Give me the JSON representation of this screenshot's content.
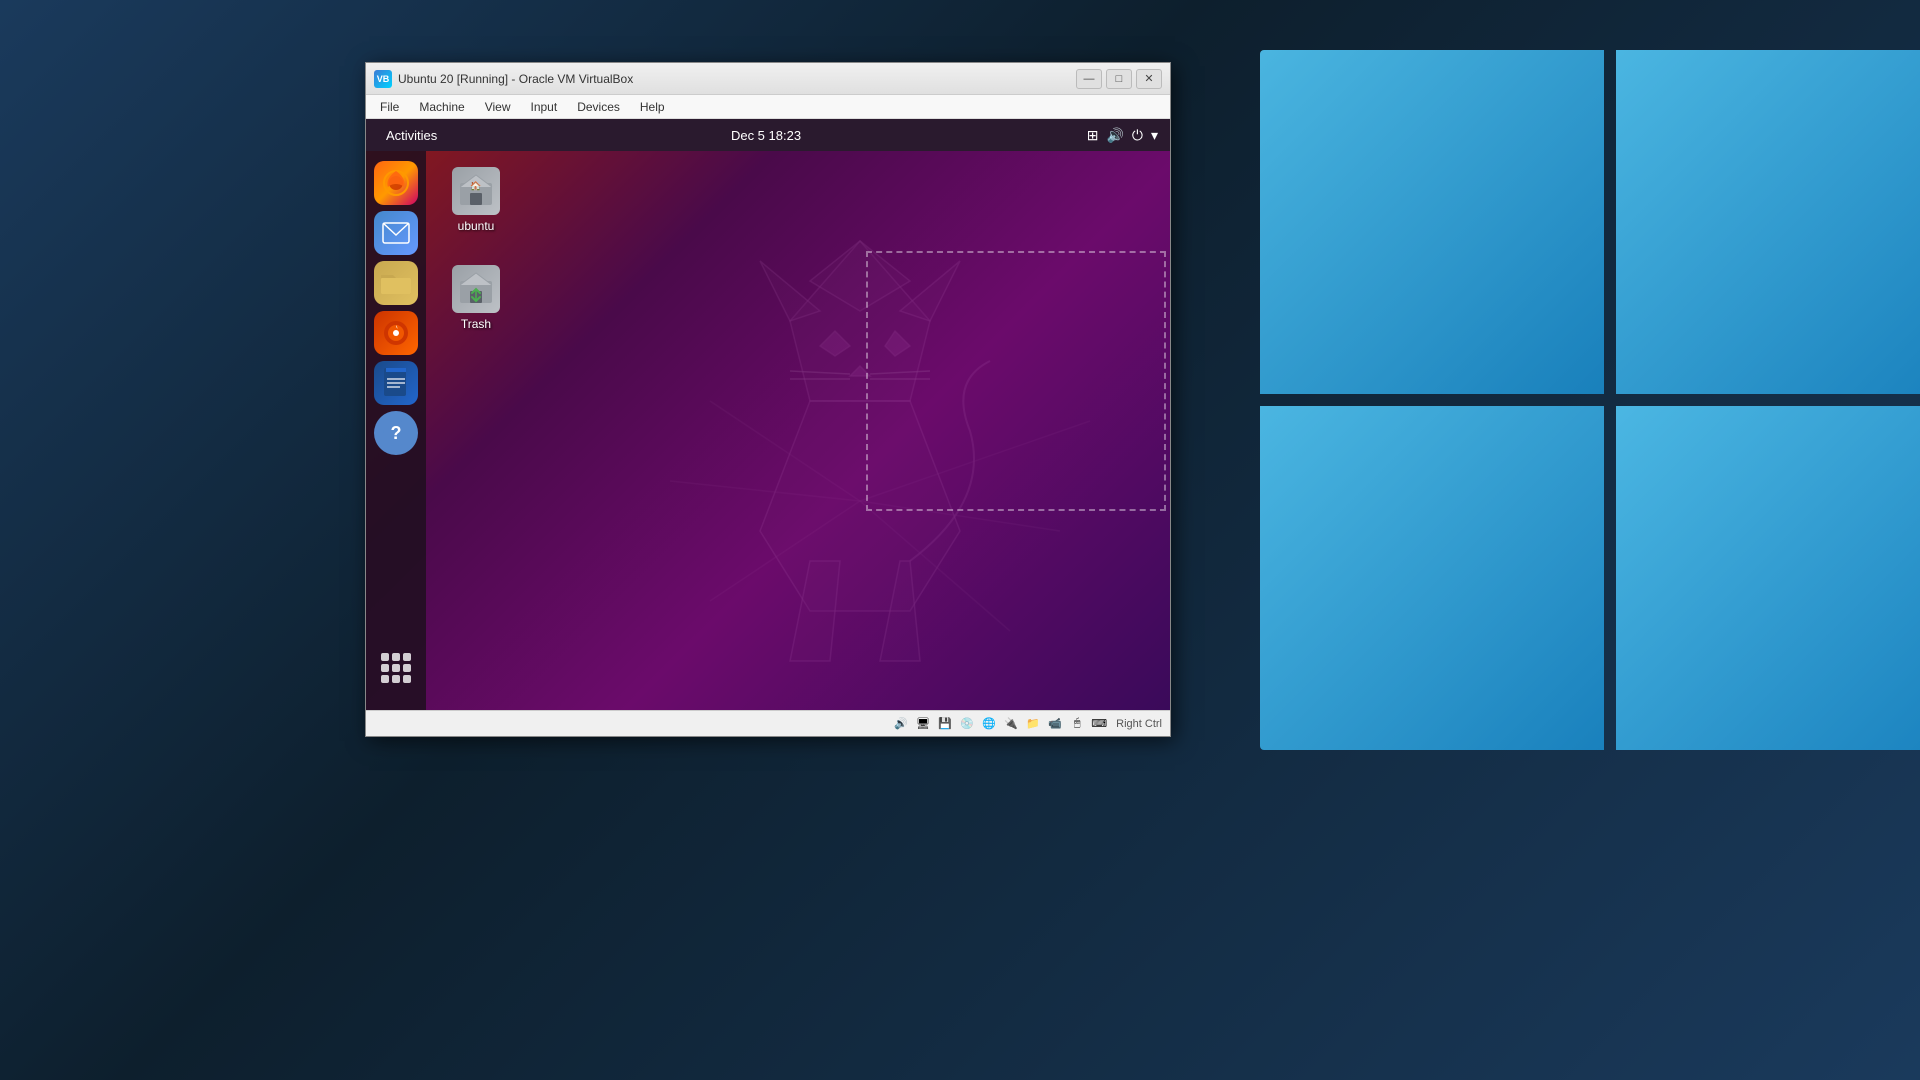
{
  "windows_desktop": {
    "background": "#1a2a3a"
  },
  "vbox_window": {
    "title": "Ubuntu 20 [Running] - Oracle VM VirtualBox",
    "icon": "VB",
    "controls": {
      "minimize": "—",
      "maximize": "□",
      "close": "✕"
    },
    "menubar": {
      "items": [
        "File",
        "Machine",
        "View",
        "Input",
        "Devices",
        "Help"
      ]
    }
  },
  "ubuntu": {
    "topbar": {
      "activities": "Activities",
      "clock": "Dec 5  18:23",
      "icons": [
        "⊞",
        "🔊",
        "⏻",
        "▾"
      ]
    },
    "sidebar": {
      "icons": [
        {
          "name": "firefox",
          "label": "Firefox"
        },
        {
          "name": "email",
          "label": "Email"
        },
        {
          "name": "files",
          "label": "Files"
        },
        {
          "name": "music",
          "label": "Rhythmbox"
        },
        {
          "name": "writer",
          "label": "Writer"
        },
        {
          "name": "help",
          "label": "Help"
        }
      ],
      "apps_grid_label": "Show Applications"
    },
    "desktop_icons": [
      {
        "name": "ubuntu-home",
        "label": "ubuntu",
        "type": "home"
      },
      {
        "name": "trash",
        "label": "Trash",
        "type": "trash"
      }
    ]
  },
  "vbox_statusbar": {
    "right_ctrl": "Right Ctrl",
    "icons": [
      "💿",
      "🖥",
      "💾",
      "📋",
      "🔌",
      "📺",
      "🖱",
      "🎮",
      "🖼",
      "⚙"
    ]
  }
}
